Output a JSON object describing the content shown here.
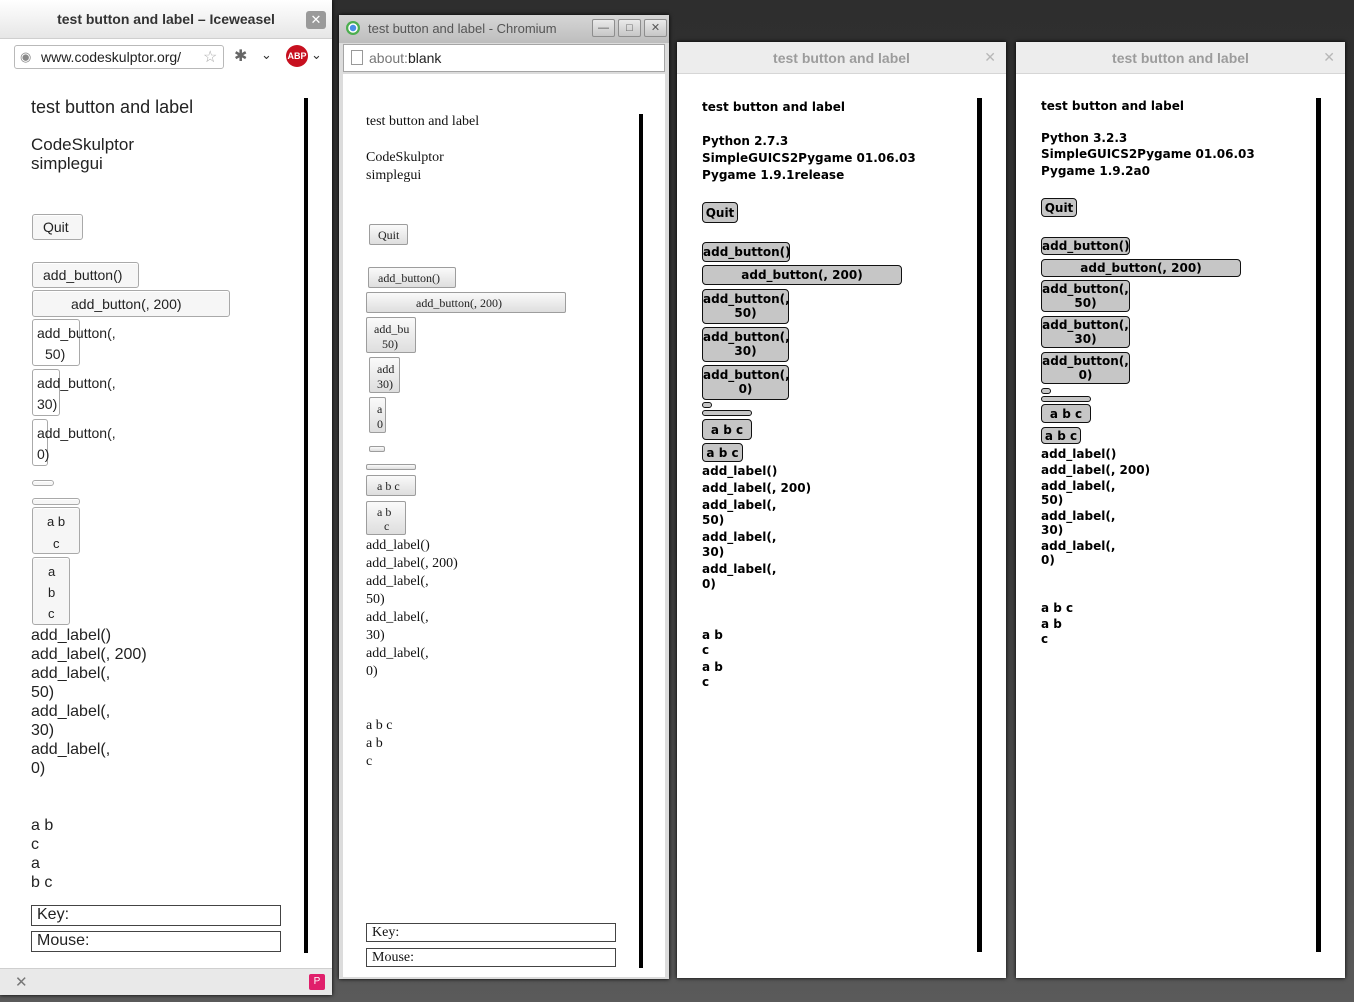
{
  "iceweasel": {
    "title": "test button and label – Iceweasel",
    "url": "www.codeskulptor.org/",
    "adblock_label": "ABP",
    "canvas_text": {
      "title": "test button and label",
      "line1": "CodeSkulptor",
      "line2": "simplegui"
    },
    "buttons": {
      "quit": "Quit",
      "b1": "add_button()",
      "b2": "add_button(, 200)",
      "b3a": "add_button(,",
      "b3b": "50)",
      "b4a": "add_button(,",
      "b4b": "30)",
      "b5a": "add_button(,",
      "b5b": "0)",
      "abc1a": "a b",
      "abc1b": "c",
      "abc2a": "a",
      "abc2b": "b",
      "abc2c": "c"
    },
    "labels": [
      "add_label()",
      "add_label(, 200)",
      "add_label(,",
      "50)",
      "add_label(,",
      "30)",
      "add_label(,",
      "0)"
    ],
    "abc_labels": [
      "a b",
      "c",
      "a",
      "b c"
    ],
    "key_label": "Key:",
    "mouse_label": "Mouse:"
  },
  "chromium": {
    "title": "test button and label - Chromium",
    "url_prefix": "about:",
    "url_path": "blank",
    "canvas_text": {
      "title": "test button and label",
      "line1": "CodeSkulptor",
      "line2": "simplegui"
    },
    "buttons": {
      "quit": "Quit",
      "b1": "add_button()",
      "b2": "add_button(, 200)",
      "b3a": "add_bu",
      "b3b": "50)",
      "b4a": "add",
      "b4b": "30)",
      "b5a": "a",
      "b5b": "0",
      "abc1": "a b c",
      "abc2a": "a b",
      "abc2b": "c"
    },
    "labels": [
      "add_label()",
      "add_label(, 200)",
      "add_label(,",
      "50)",
      "add_label(,",
      "30)",
      "add_label(,",
      "0)"
    ],
    "abc_labels": [
      "a b c",
      "a b",
      "c"
    ],
    "key_label": "Key:",
    "mouse_label": "Mouse:"
  },
  "pygame27": {
    "title": "test button and label",
    "info": [
      "test button and label",
      "Python 2.7.3",
      "SimpleGUICS2Pygame 01.06.03",
      "Pygame 1.9.1release"
    ],
    "buttons": {
      "quit": "Quit",
      "b1": "add_button()",
      "b2": "add_button(, 200)",
      "b3a": "add_button(,",
      "b3b": "50)",
      "b4a": "add_button(,",
      "b4b": "30)",
      "b5a": "add_button(,",
      "b5b": "0)",
      "abc1": "a b c",
      "abc2": "a b c"
    },
    "labels": [
      "add_label()",
      "add_label(, 200)",
      "add_label(,",
      "50)",
      "add_label(,",
      "30)",
      "add_label(,",
      "0)"
    ],
    "abc_labels": [
      "a b",
      "c",
      "a b",
      "c"
    ]
  },
  "pygame32": {
    "title": "test button and label",
    "info": [
      "test button and label",
      "Python 3.2.3",
      "SimpleGUICS2Pygame 01.06.03",
      "Pygame 1.9.2a0"
    ],
    "buttons": {
      "quit": "Quit",
      "b1": "add_button()",
      "b2": "add_button(, 200)",
      "b3a": "add_button(,",
      "b3b": "50)",
      "b4a": "add_button(,",
      "b4b": "30)",
      "b5a": "add_button(,",
      "b5b": "0)",
      "abc1": "a b c",
      "abc2": "a b c"
    },
    "labels": [
      "add_label()",
      "add_label(, 200)",
      "add_label(,",
      "50)",
      "add_label(,",
      "30)",
      "add_label(,",
      "0)"
    ],
    "abc_labels": [
      "a b c",
      "a b",
      "c"
    ]
  },
  "colors": {
    "abp_red": "#c7101f",
    "button_gray": "#c6c6c6",
    "canvas_border": "#000000"
  }
}
